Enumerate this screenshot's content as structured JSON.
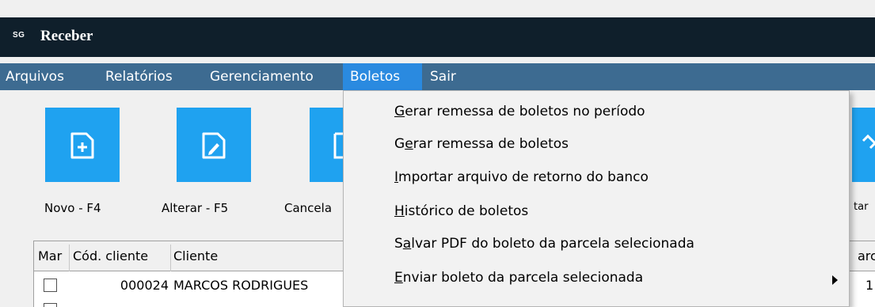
{
  "window": {
    "logo": "SG",
    "title": "Receber"
  },
  "menubar": {
    "items": [
      {
        "label": "Arquivos"
      },
      {
        "label": "Relatórios"
      },
      {
        "label": "Gerenciamento"
      },
      {
        "label": "Boletos",
        "active": true
      },
      {
        "label": "Sair"
      }
    ]
  },
  "toolbar": {
    "buttons": [
      {
        "label": "Novo - F4",
        "icon": "file-plus-icon"
      },
      {
        "label": "Alterar - F5",
        "icon": "file-edit-icon"
      },
      {
        "label": "Cancela",
        "icon": "file-icon"
      },
      {
        "label": "tar",
        "icon": "tag-icon"
      }
    ]
  },
  "grid": {
    "columns": [
      "Mar",
      "Cód. cliente",
      "Cliente",
      "arc."
    ],
    "rows": [
      {
        "marked": false,
        "cod_cliente": "000024",
        "cliente": "MARCOS RODRIGUES",
        "parc": "1"
      }
    ]
  },
  "boletos_menu": {
    "items": [
      {
        "pre": "",
        "key": "G",
        "post": "erar remessa de boletos no período"
      },
      {
        "pre": "G",
        "key": "e",
        "post": "rar remessa de boletos"
      },
      {
        "pre": "",
        "key": "I",
        "post": "mportar arquivo de retorno do banco"
      },
      {
        "pre": "",
        "key": "H",
        "post": "istórico de boletos"
      },
      {
        "pre": "S",
        "key": "a",
        "post": "lvar PDF do boleto da parcela selecionada"
      },
      {
        "pre": "",
        "key": "E",
        "post": "nviar boleto da parcela selecionada",
        "has_submenu": true
      }
    ]
  },
  "colors": {
    "titlebar": "#0f1f2b",
    "menubar": "#3d6b91",
    "menu_active": "#2a8ae0",
    "tool_button": "#1fa2f0"
  }
}
